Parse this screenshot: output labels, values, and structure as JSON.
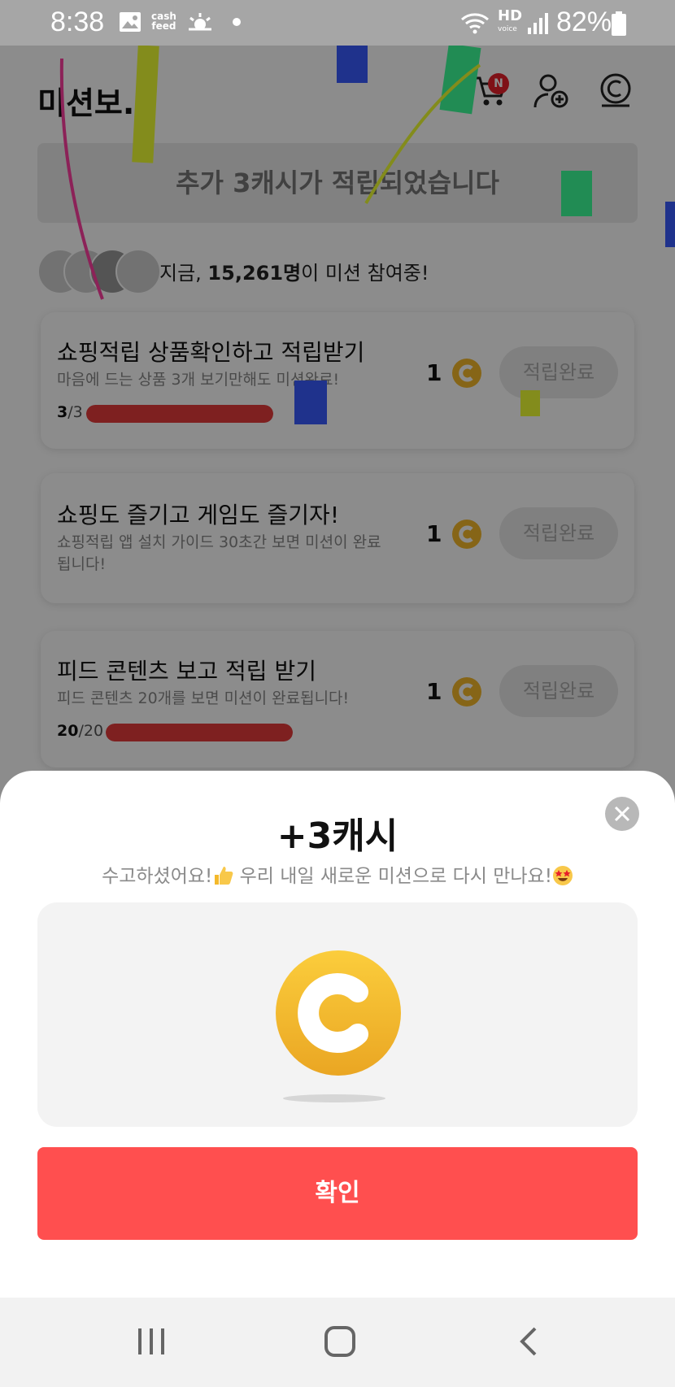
{
  "status_bar": {
    "time": "8:38",
    "cashfeed_top": "cash",
    "cashfeed_bottom": "feed",
    "hd": "HD",
    "hd_sub": "voice",
    "battery": "82%"
  },
  "header": {
    "title": "미션보..",
    "cart_badge": "N",
    "icons": [
      "cart-icon",
      "add-friend-icon",
      "cash-icon"
    ]
  },
  "notice": "추가 3캐시가 적립되었습니다",
  "participants": {
    "prefix": "지금, ",
    "count": "15,261명",
    "suffix": "이 미션 참여중!"
  },
  "missions": [
    {
      "title": "쇼핑적립 상품확인하고 적립받기",
      "desc": "마음에 드는 상품 3개 보기만해도 미션완료!",
      "progress_current": "3",
      "progress_total": "/3",
      "progress_fraction": 1.0,
      "reward": "1",
      "button": "적립완료"
    },
    {
      "title": "쇼핑도 즐기고 게임도 즐기자!",
      "desc": "쇼핑적립 앱 설치 가이드 30초간 보면 미션이 완료됩니다!",
      "reward": "1",
      "button": "적립완료"
    },
    {
      "title": "피드 콘텐츠 보고 적립 받기",
      "desc": "피드 콘텐츠 20개를 보면 미션이 완료됩니다!",
      "progress_current": "20",
      "progress_total": "/20",
      "progress_fraction": 1.0,
      "reward": "1",
      "button": "적립완료"
    }
  ],
  "modal": {
    "title": "+3캐시",
    "subtitle_part1": "수고하셨어요!",
    "subtitle_part2": " 우리 내일 새로운 미션으로 다시 만나요!",
    "confirm_label": "확인"
  },
  "colors": {
    "accent": "#ff4f4f",
    "coin": "#f4b92b",
    "badge": "#e8202a"
  },
  "nav_bar": {
    "icons": [
      "recent-apps-icon",
      "home-icon",
      "back-icon"
    ]
  }
}
